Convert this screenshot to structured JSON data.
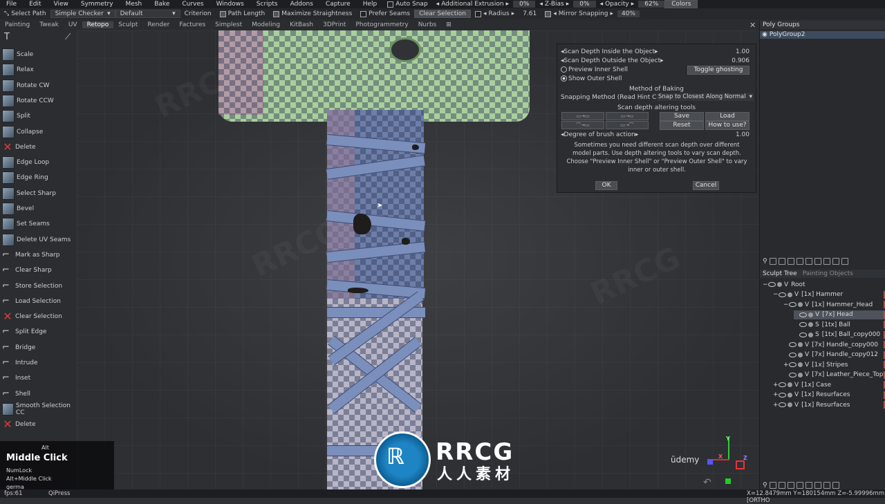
{
  "menubar": {
    "items": [
      "File",
      "Edit",
      "View",
      "Symmetry",
      "Mesh",
      "Bake",
      "Curves",
      "Windows",
      "Scripts",
      "Addons",
      "Capture",
      "Help"
    ],
    "auto_snap": "Auto Snap",
    "additional_extrusion": "Additional Extrusion",
    "extrusion_val": "0%",
    "z_bias": "Z-Bias",
    "zbias_val": "0%",
    "opacity": "Opacity",
    "opacity_val": "62%",
    "colors": "Colors"
  },
  "toolbar": {
    "select_path": "Select Path",
    "mode_select": "Simple Checker",
    "default_select": "Default",
    "criterion": "Criterion",
    "path_length": "Path Length",
    "maximize_straightness": "Maximize Straightness",
    "prefer_seams": "Prefer Seams",
    "clear_selection": "Clear Selection",
    "radius_label": "Radius",
    "radius_val": "7.61",
    "mirror_snapping": "Mirror Snapping",
    "mirror_val": "40%"
  },
  "tabs": [
    "Painting",
    "Tweak",
    "UV",
    "Retopo",
    "Sculpt",
    "Render",
    "Factures",
    "Simplest",
    "Modeling",
    "KitBash",
    "3DPrint",
    "Photogrammetry",
    "Nurbs"
  ],
  "active_tab": "Retopo",
  "tools": [
    {
      "label": "Scale",
      "icon": "scale-icon"
    },
    {
      "label": "Relax",
      "icon": "relax-icon"
    },
    {
      "label": "Rotate CW",
      "icon": "rotate-cw-icon"
    },
    {
      "label": "Rotate CCW",
      "icon": "rotate-ccw-icon"
    },
    {
      "label": "Split",
      "icon": "split-icon"
    },
    {
      "label": "Collapse",
      "icon": "collapse-icon"
    },
    {
      "label": "Delete",
      "icon": "delete-icon"
    },
    {
      "label": "Edge Loop",
      "icon": "edge-loop-icon"
    },
    {
      "label": "Edge Ring",
      "icon": "edge-ring-icon"
    },
    {
      "label": "Select Sharp",
      "icon": "select-sharp-icon"
    },
    {
      "label": "Bevel",
      "icon": "bevel-icon"
    },
    {
      "label": "Set Seams",
      "icon": "set-seams-icon"
    },
    {
      "label": "Delete UV Seams",
      "icon": "delete-uv-seams-icon"
    },
    {
      "label": "Mark as Sharp",
      "icon": "mark-sharp-icon"
    },
    {
      "label": "Clear Sharp",
      "icon": "clear-sharp-icon"
    },
    {
      "label": "Store Selection",
      "icon": "store-selection-icon"
    },
    {
      "label": "Load Selection",
      "icon": "load-selection-icon"
    },
    {
      "label": "Clear Selection",
      "icon": "clear-selection-icon"
    },
    {
      "label": "Split Edge",
      "icon": "split-edge-icon"
    },
    {
      "label": "Bridge",
      "icon": "bridge-icon"
    },
    {
      "label": "Intrude",
      "icon": "intrude-icon"
    },
    {
      "label": "Inset",
      "icon": "inset-icon"
    },
    {
      "label": "Shell",
      "icon": "shell-icon"
    },
    {
      "label": "Smooth Selection CC",
      "icon": "smooth-selection-icon"
    },
    {
      "label": "Delete",
      "icon": "delete-icon"
    }
  ],
  "dialog": {
    "scan_inside_label": "Scan Depth Inside the Object",
    "scan_inside_val": "1.00",
    "scan_outside_label": "Scan Depth Outside the Object",
    "scan_outside_val": "0.906",
    "preview_inner": "Preview Inner Shell",
    "toggle_ghosting": "Toggle ghosting",
    "show_outer": "Show Outer Shell",
    "method_title": "Method of Baking",
    "snapping_method_label": "Snapping Method (Read Hint Care",
    "snapping_method_val": "Snap to Closest Along Normal",
    "scan_tools_title": "Scan depth altering tools",
    "save": "Save",
    "load": "Load",
    "reset": "Reset",
    "how_to_use": "How to use?",
    "degree_label": "Degree of brush action",
    "degree_val": "1.00",
    "description": "Sometimes you need different scan depth over different model parts. Use depth altering tools to vary scan depth. Choose \"Preview Inner Shell\" or \"Preview Outer Shell\" to vary inner or outer shell.",
    "ok": "OK",
    "cancel": "Cancel"
  },
  "right_panel": {
    "tab_poly_groups": "Poly Groups",
    "poly_group_item": "PolyGroup2",
    "tab_sculpt_tree": "Sculpt Tree",
    "tab_painting_objects": "Painting Objects",
    "tree": [
      {
        "label": "Root",
        "type": "V",
        "indent": 0,
        "expand": "−"
      },
      {
        "label": "[1x]  Hammer",
        "type": "V",
        "indent": 1,
        "expand": "−"
      },
      {
        "label": "[1x]  Hammer_Head",
        "type": "V",
        "indent": 2,
        "expand": "−"
      },
      {
        "label": "[7x]  Head",
        "type": "V",
        "indent": 3,
        "expand": ""
      },
      {
        "label": "[1tx]  Ball",
        "type": "S",
        "indent": 3,
        "expand": ""
      },
      {
        "label": "[1tx]  Ball_copy000",
        "type": "S",
        "indent": 3,
        "expand": ""
      },
      {
        "label": "[7x]  Handle_copy000",
        "type": "V",
        "indent": 2,
        "expand": ""
      },
      {
        "label": "[7x]  Handle_copy012",
        "type": "V",
        "indent": 2,
        "expand": ""
      },
      {
        "label": "[1x]  Stripes",
        "type": "V",
        "indent": 2,
        "expand": "+"
      },
      {
        "label": "[7x]  Leather_Piece_Top",
        "type": "V",
        "indent": 2,
        "expand": ""
      },
      {
        "label": "[1x]  Case",
        "type": "V",
        "indent": 1,
        "expand": "+"
      },
      {
        "label": "[1x]  Resurfaces",
        "type": "V",
        "indent": 1,
        "expand": "+"
      },
      {
        "label": "[1x]  Resurfaces",
        "type": "V",
        "indent": 1,
        "expand": "+"
      }
    ]
  },
  "hint": {
    "alt": "Alt",
    "title": "Middle Click",
    "numlock": "NumLock",
    "shortcut": "Alt+Middle Click",
    "extra": "germa"
  },
  "status": {
    "left": "fps:61",
    "qipress": "QiPress",
    "coords": "X=12.8479mm  Y=180154mm  Z=-5.99996mm  [ORTHO"
  },
  "watermark": {
    "brand": "RRCG",
    "sub": "人人素材",
    "udemy": "ūdemy"
  },
  "axes": {
    "x": "X",
    "y": "Y",
    "z": "Z"
  },
  "colors": {
    "accent_sel": "#3d4b5e",
    "green_head": "#a9cf9c",
    "blue_handle": "#6d7ea9"
  }
}
